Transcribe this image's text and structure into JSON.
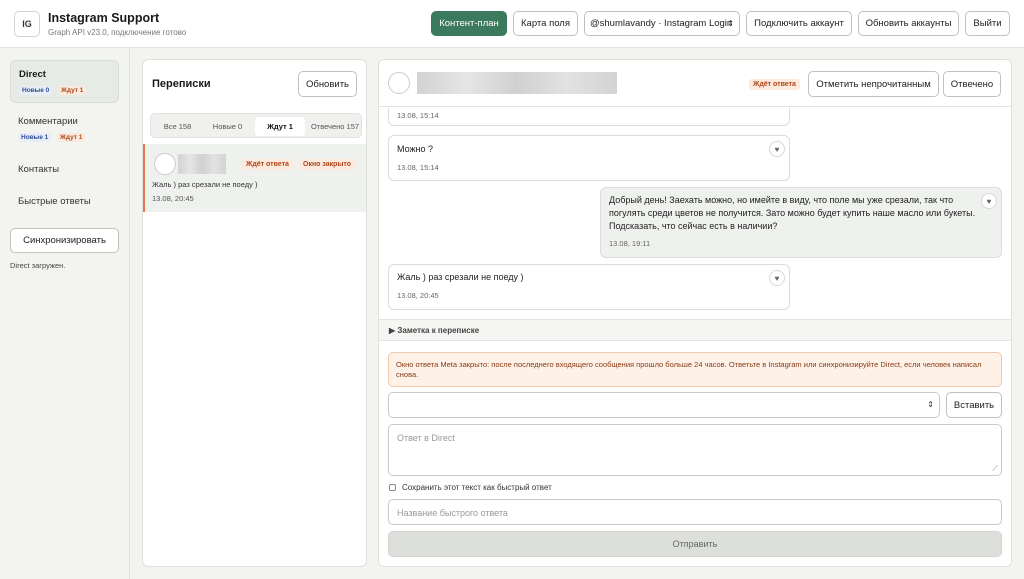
{
  "header": {
    "logo": "IG",
    "title": "Instagram Support",
    "subtitle": "Graph API v23.0, подключение готово",
    "buttons": {
      "content_plan": "Контент-план",
      "field_map": "Карта поля",
      "account_select": "@shumlavandy · Instagram Login",
      "connect": "Подключить аккаунт",
      "refresh_accounts": "Обновить аккаунты",
      "logout": "Выйти"
    }
  },
  "sidebar": {
    "direct": {
      "label": "Direct",
      "new": "Новые 0",
      "wait": "Ждут 1"
    },
    "comments": {
      "label": "Комментарии",
      "new": "Новые 1",
      "wait": "Ждут 1"
    },
    "contacts": "Контакты",
    "quick_replies": "Быстрые ответы",
    "sync_button": "Синхронизировать",
    "status": "Direct загружен."
  },
  "conversations": {
    "title": "Переписки",
    "refresh": "Обновить",
    "tabs": [
      "Все 158",
      "Новые 0",
      "Ждут 1",
      "Отвечено 157"
    ],
    "active_tab": 2,
    "item": {
      "status_wait": "Ждёт ответа",
      "status_closed": "Окно закрыто",
      "preview": "Жаль ) раз срезали не поеду )",
      "time": "13.08, 20:45"
    }
  },
  "chat": {
    "status": "Ждёт ответа",
    "mark_unread": "Отметить непрочитанным",
    "answered": "Отвечено",
    "messages": [
      {
        "text": "",
        "time": "13.08, 15:14"
      },
      {
        "text": "Можно ?",
        "time": "13.08, 15:14"
      },
      {
        "text": "Добрый день! Заехать можно, но имейте в виду, что поле мы уже срезали, так что погулять среди цветов не получится. Зато можно будет купить наше масло или букеты. Подсказать, что сейчас есть в наличии?",
        "time": "13.08, 19:11"
      },
      {
        "text": "Жаль ) раз срезали не поеду )",
        "time": "13.08, 20:45"
      }
    ],
    "note_toggle": "▶ Заметка к переписке",
    "warning": "Окно ответа Meta закрыто: после последнего входящего сообщения прошло больше 24 часов. Ответьте в Instagram или синхронизируйте Direct, если человек написал снова.",
    "insert_button": "Вставить",
    "reply_placeholder": "Ответ в Direct",
    "save_quick_label": "Сохранить этот текст как быстрый ответ",
    "quick_name_placeholder": "Название быстрого ответа",
    "send_button": "Отправить"
  }
}
